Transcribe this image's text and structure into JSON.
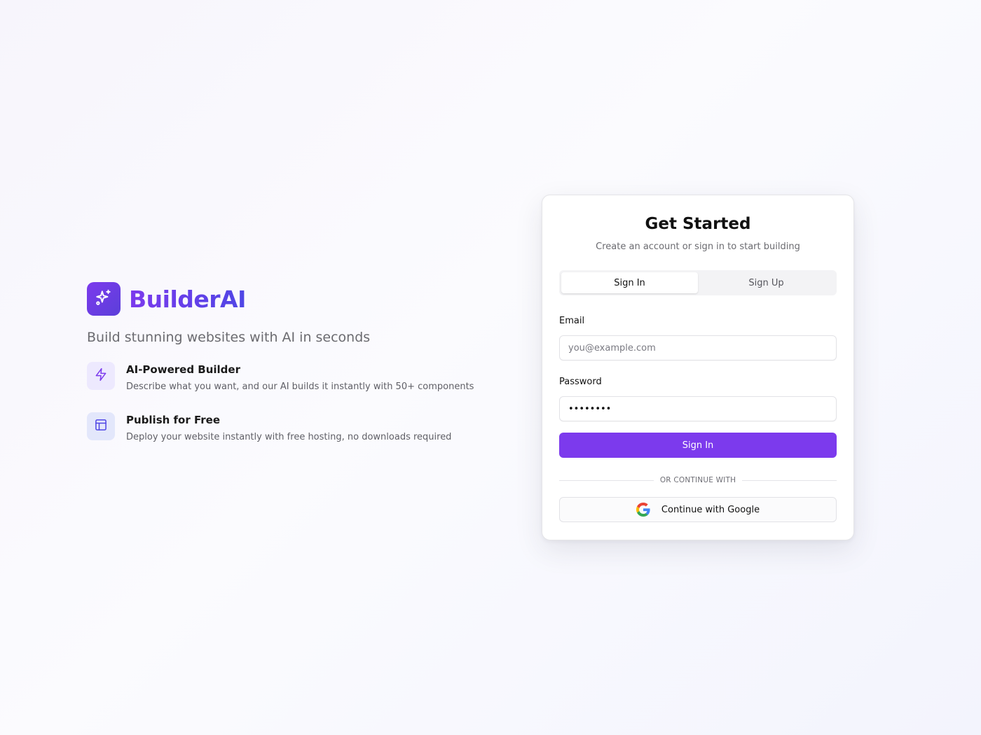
{
  "brand": {
    "name": "BuilderAI",
    "tagline": "Build stunning websites with AI in seconds",
    "logo_icon": "sparkles-icon",
    "accent": "#7c3aed"
  },
  "features": [
    {
      "icon": "zap-icon",
      "title": "AI-Powered Builder",
      "description": "Describe what you want, and our AI builds it instantly with 50+ components"
    },
    {
      "icon": "layout-icon",
      "title": "Publish for Free",
      "description": "Deploy your website instantly with free hosting, no downloads required"
    }
  ],
  "auth": {
    "title": "Get Started",
    "subtitle": "Create an account or sign in to start building",
    "tabs": [
      {
        "label": "Sign In",
        "active": true
      },
      {
        "label": "Sign Up",
        "active": false
      }
    ],
    "email": {
      "label": "Email",
      "placeholder": "you@example.com",
      "value": ""
    },
    "password": {
      "label": "Password",
      "value": "••••••••"
    },
    "submit_label": "Sign In",
    "divider_text": "OR CONTINUE WITH",
    "google_label": "Continue with Google",
    "google_icon": "google-icon"
  }
}
